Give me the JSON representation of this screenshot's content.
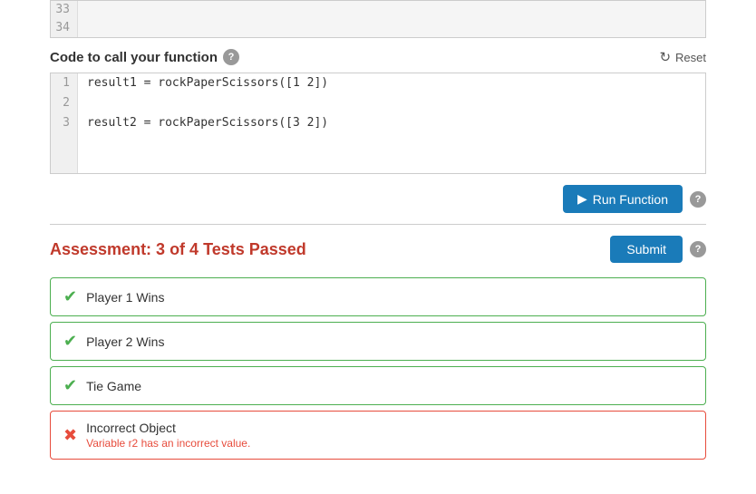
{
  "top_stub": {
    "lines": [
      {
        "num": "33",
        "content": ""
      },
      {
        "num": "34",
        "content": ""
      }
    ]
  },
  "section": {
    "title": "Code to call your function",
    "help_icon": "?",
    "reset_label": "Reset"
  },
  "editor": {
    "lines": [
      {
        "num": "1",
        "content": "result1 = rockPaperScissors([1 2])"
      },
      {
        "num": "2",
        "content": ""
      },
      {
        "num": "3",
        "content": "result2 = rockPaperScissors([3 2])"
      }
    ]
  },
  "run_button": {
    "label": "Run Function"
  },
  "assessment": {
    "title": "Assessment: 3 of 4 Tests Passed",
    "submit_label": "Submit",
    "help_icon": "?"
  },
  "tests": [
    {
      "id": "player1",
      "label": "Player 1 Wins",
      "status": "pass",
      "error": null
    },
    {
      "id": "player2",
      "label": "Player 2 Wins",
      "status": "pass",
      "error": null
    },
    {
      "id": "tie",
      "label": "Tie Game",
      "status": "pass",
      "error": null
    },
    {
      "id": "incorrect",
      "label": "Incorrect Object",
      "status": "fail",
      "error": "Variable r2 has an incorrect value."
    }
  ],
  "colors": {
    "pass_border": "#4caf50",
    "fail_border": "#e74c3c",
    "title_color": "#c0392b",
    "button_bg": "#1a7bb9"
  }
}
